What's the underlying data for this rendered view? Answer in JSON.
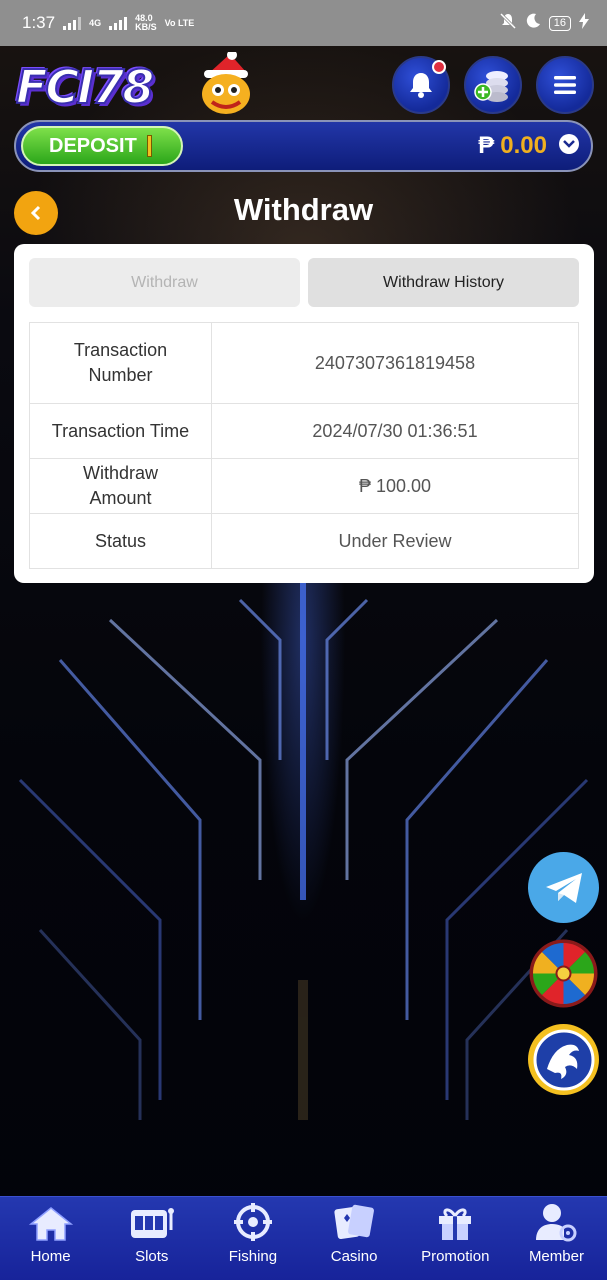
{
  "status_bar": {
    "time": "1:37",
    "net_type": "4G",
    "speed": "48.0",
    "speed_unit": "KB/S",
    "volte": "Vo LTE",
    "battery": "16"
  },
  "header": {
    "logo_text": "FCI78",
    "notification_dot": true
  },
  "deposit_bar": {
    "deposit_label": "DEPOSIT",
    "currency_symbol": "₱",
    "balance": "0.00"
  },
  "page": {
    "title": "Withdraw"
  },
  "tabs": [
    {
      "label": "Withdraw",
      "active": false
    },
    {
      "label": "Withdraw History",
      "active": true
    }
  ],
  "transaction": {
    "rows": [
      {
        "key": "Transaction Number",
        "value": "2407307361819458"
      },
      {
        "key": "Transaction Time",
        "value": "2024/07/30 01:36:51"
      },
      {
        "key": "Withdraw Amount",
        "value": "₱ 100.00"
      },
      {
        "key": "Status",
        "value": "Under Review"
      }
    ]
  },
  "floating_buttons": [
    "telegram-icon",
    "lucky-wheel-icon",
    "dragon-icon"
  ],
  "bottom_nav": [
    {
      "label": "Home",
      "icon": "home-icon"
    },
    {
      "label": "Slots",
      "icon": "slots-icon"
    },
    {
      "label": "Fishing",
      "icon": "fishing-icon"
    },
    {
      "label": "Casino",
      "icon": "casino-icon"
    },
    {
      "label": "Promotion",
      "icon": "promotion-icon"
    },
    {
      "label": "Member",
      "icon": "member-icon"
    }
  ],
  "colors": {
    "nav_bg": "#1e2fa8",
    "deposit_green": "#3cb824",
    "balance_gold": "#f0b020",
    "back_button": "#f2a410"
  }
}
